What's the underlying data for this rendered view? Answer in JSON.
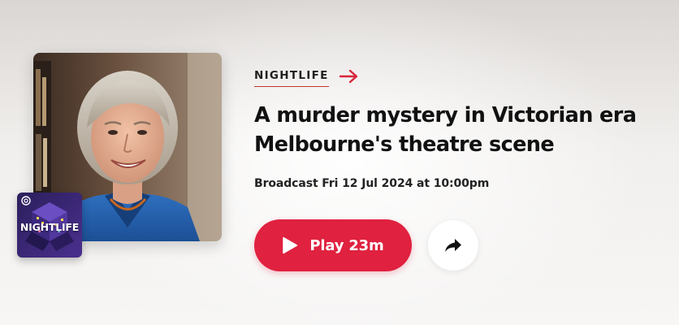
{
  "program": {
    "category": "NIGHTLIFE",
    "badge_label": "NIGHTLIFE"
  },
  "episode": {
    "title": "A murder mystery in Victorian era Melbourne's theatre scene",
    "broadcast": "Broadcast Fri 12 Jul 2024 at 10:00pm"
  },
  "actions": {
    "play_label": "Play 23m",
    "share_icon": "share-arrow-icon"
  },
  "colors": {
    "accent": "#e0213f",
    "category_arrow": "#d7263d",
    "badge_bg": "#3a2a7a"
  }
}
